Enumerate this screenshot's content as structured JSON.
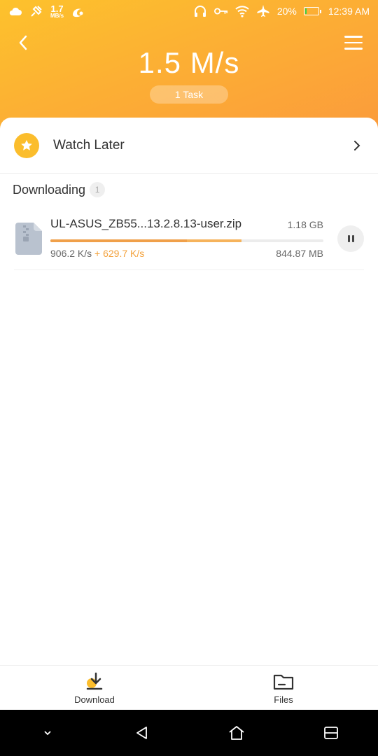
{
  "status_bar": {
    "net_speed_value": "1.7",
    "net_speed_unit": "MB/s",
    "battery_percent": "20%",
    "battery_level": 0.2,
    "time": "12:39 AM"
  },
  "header": {
    "speed": "1.5 M/s",
    "task_pill": "1 Task"
  },
  "watch_later": {
    "label": "Watch Later"
  },
  "downloading": {
    "title": "Downloading",
    "count": "1",
    "items": [
      {
        "file_name": "UL-ASUS_ZB55...13.2.8.13-user.zip",
        "total_size": "1.18 GB",
        "speed": "906.2 K/s",
        "extra_speed": "+ 629.7 K/s",
        "downloaded": "844.87 MB",
        "progress": 0.7,
        "progress_primary": 0.5
      }
    ]
  },
  "bottom_nav": {
    "download_label": "Download",
    "files_label": "Files"
  },
  "colors": {
    "accent": "#fbbd2c",
    "accent_dark": "#f0a04a",
    "extra_speed": "#f3a13b"
  }
}
